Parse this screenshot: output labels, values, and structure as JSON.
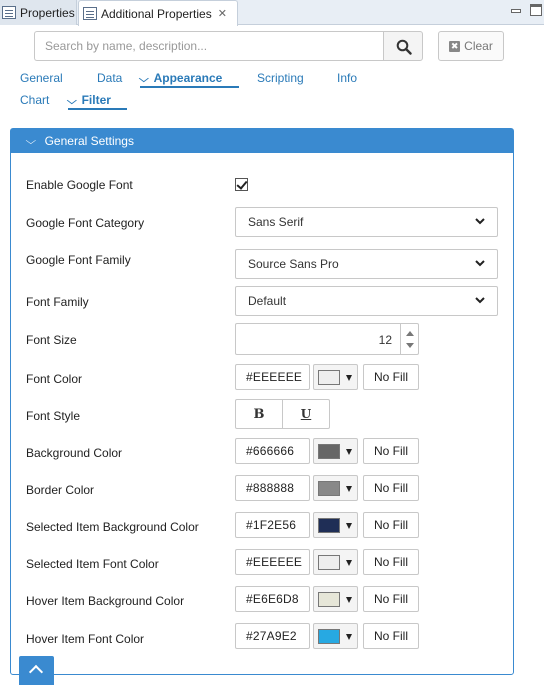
{
  "tabs": [
    {
      "label": "Properties"
    },
    {
      "label": "Additional Properties"
    }
  ],
  "search": {
    "placeholder": "Search by name, description...",
    "clear_label": "Clear"
  },
  "nav": {
    "row1": [
      "General",
      "Data",
      "Appearance",
      "Scripting",
      "Info"
    ],
    "row2": [
      "Chart",
      "Filter"
    ],
    "active": [
      "Appearance",
      "Filter"
    ]
  },
  "panel": {
    "title": "General Settings",
    "accent_color": "#3a8ad0"
  },
  "fields": {
    "enable_google_font": {
      "label": "Enable Google Font",
      "checked": true
    },
    "google_font_category": {
      "label": "Google Font Category",
      "value": "Sans Serif"
    },
    "google_font_family": {
      "label": "Google Font Family",
      "value": "Source Sans Pro"
    },
    "font_family": {
      "label": "Font Family",
      "value": "Default"
    },
    "font_size": {
      "label": "Font Size",
      "value": "12"
    },
    "font_color": {
      "label": "Font Color",
      "hex": "#EEEEEE",
      "swatch": "#eeeeee",
      "nofill": "No Fill"
    },
    "font_style": {
      "label": "Font Style",
      "bold": "B",
      "underline": "U"
    },
    "background_color": {
      "label": "Background Color",
      "hex": "#666666",
      "swatch": "#666666",
      "nofill": "No Fill"
    },
    "border_color": {
      "label": "Border Color",
      "hex": "#888888",
      "swatch": "#888888",
      "nofill": "No Fill"
    },
    "selected_item_bg_color": {
      "label": "Selected Item Background Color",
      "hex": "#1F2E56",
      "swatch": "#1f2e56",
      "nofill": "No Fill"
    },
    "selected_item_font_color": {
      "label": "Selected Item Font Color",
      "hex": "#EEEEEE",
      "swatch": "#eeeeee",
      "nofill": "No Fill"
    },
    "hover_item_bg_color": {
      "label": "Hover Item Background Color",
      "hex": "#E6E6D8",
      "swatch": "#e6e6d8",
      "nofill": "No Fill"
    },
    "hover_item_font_color": {
      "label": "Hover Item Font Color",
      "hex": "#27A9E2",
      "swatch": "#27a9e2",
      "nofill": "No Fill"
    }
  }
}
